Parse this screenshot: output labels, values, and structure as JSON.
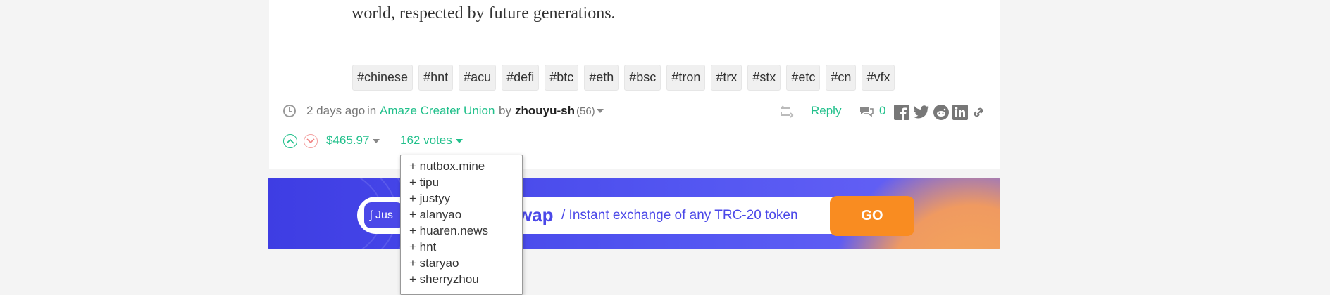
{
  "post": {
    "body_tail": "world, respected by future generations.",
    "tags": [
      "#chinese",
      "#hnt",
      "#acu",
      "#defi",
      "#btc",
      "#eth",
      "#bsc",
      "#tron",
      "#trx",
      "#stx",
      "#etc",
      "#cn",
      "#vfx"
    ]
  },
  "meta": {
    "time": "2 days ago",
    "in_word": "in",
    "community": "Amaze Creater Union",
    "by_word": "by",
    "author": "zhouyu-sh",
    "reputation": "(56)",
    "reply_label": "Reply",
    "comment_count": "0"
  },
  "votes": {
    "payout": "$465.97",
    "count_label": "162 votes",
    "voters": [
      "+ nutbox.mine",
      "+ tipu",
      "+ justyy",
      "+ alanyao",
      "+ huaren.news",
      "+ hnt",
      "+ staryao",
      "+ sherryzhou"
    ]
  },
  "banner": {
    "logo_text": "Jus",
    "brand": "wap",
    "tagline": "/ Instant exchange of any TRC-20 token",
    "cta": "GO"
  },
  "icons": [
    "clock-icon",
    "chevron-up-icon",
    "chevron-down-icon",
    "reblog-icon",
    "comment-icon",
    "facebook-icon",
    "twitter-icon",
    "reddit-icon",
    "linkedin-icon",
    "link-icon"
  ]
}
